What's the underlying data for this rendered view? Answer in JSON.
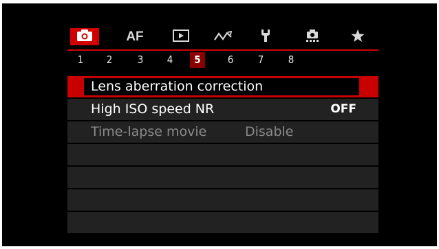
{
  "tabs": [
    {
      "id": "shooting",
      "icon": "camera-icon",
      "label": "",
      "active": true
    },
    {
      "id": "af",
      "icon": "",
      "label": "AF",
      "active": false
    },
    {
      "id": "playback",
      "icon": "play-icon",
      "label": "",
      "active": false
    },
    {
      "id": "wireless",
      "icon": "wireless-icon",
      "label": "",
      "active": false
    },
    {
      "id": "setup",
      "icon": "wrench-icon",
      "label": "",
      "active": false
    },
    {
      "id": "custom",
      "icon": "custom-functions-icon",
      "label": "",
      "active": false
    },
    {
      "id": "mymenu",
      "icon": "star-icon",
      "label": "",
      "active": false
    }
  ],
  "pages": [
    "1",
    "2",
    "3",
    "4",
    "5",
    "6",
    "7",
    "8"
  ],
  "active_page": "5",
  "menu": {
    "rows": [
      {
        "name": "Lens aberration correction",
        "value": "",
        "state": "selected"
      },
      {
        "name": "High ISO speed NR",
        "value": "OFF",
        "state": "normal"
      },
      {
        "name": "Time-lapse movie",
        "value": "Disable",
        "state": "disabled"
      },
      {
        "name": "",
        "value": "",
        "state": "empty"
      },
      {
        "name": "",
        "value": "",
        "state": "empty"
      },
      {
        "name": "",
        "value": "",
        "state": "empty"
      },
      {
        "name": "",
        "value": "",
        "state": "empty"
      }
    ]
  },
  "colors": {
    "accent": "#d10000",
    "active_page": "#8a0000",
    "row_bg": "#222222",
    "disabled_text": "#8a8a8a"
  }
}
